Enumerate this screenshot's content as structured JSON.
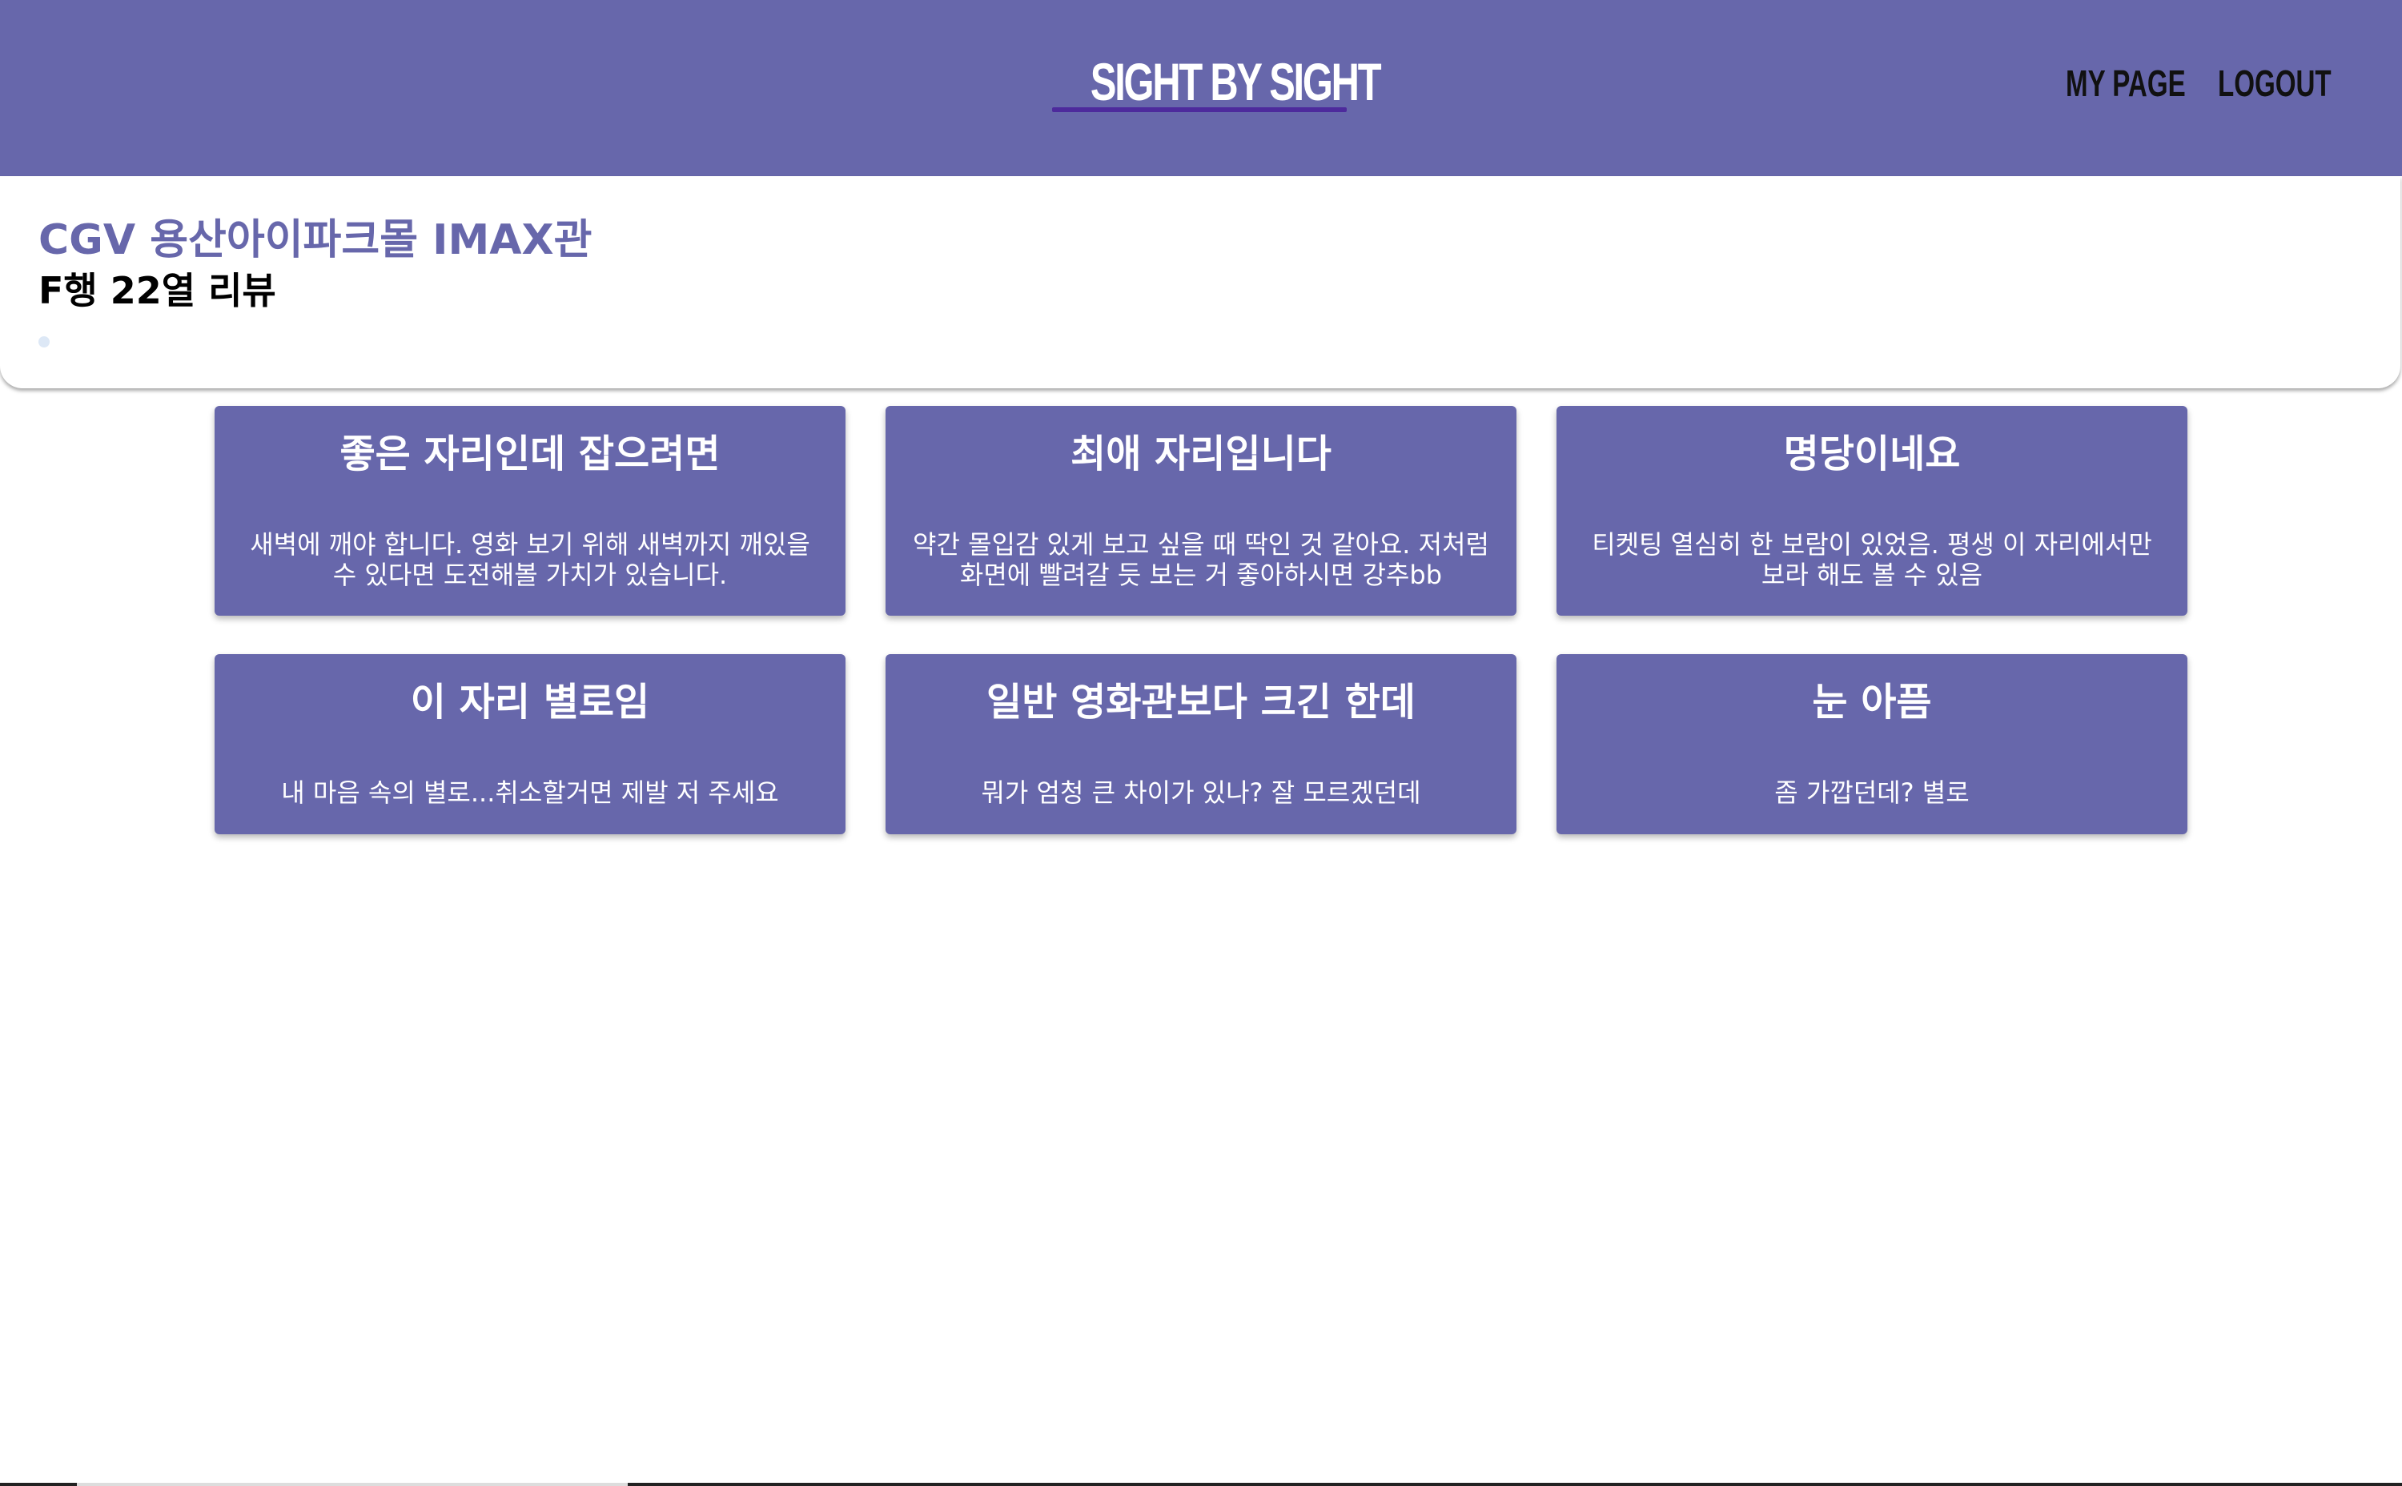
{
  "header": {
    "logo": "SIGHT BY SIGHT",
    "nav": {
      "mypage": "MY PAGE",
      "logout": "LOGOUT"
    },
    "background_color": "#6767ab"
  },
  "theater": {
    "name": "CGV 용산아이파크몰 IMAX관",
    "seat_title": "F행 22열 리뷰",
    "accent_color": "#6767ab"
  },
  "reviews": [
    {
      "title": "좋은 자리인데 잡으려면",
      "body": "새벽에 깨야 합니다. 영화 보기 위해 새벽까지 깨있을 수 있다면 도전해볼 가치가 있습니다."
    },
    {
      "title": "최애 자리입니다",
      "body": "약간 몰입감 있게 보고 싶을 때 딱인 것 같아요. 저처럼 화면에 빨려갈 듯 보는 거 좋아하시면 강추bb"
    },
    {
      "title": "명당이네요",
      "body": "티켓팅 열심히 한 보람이 있었음. 평생 이 자리에서만 보라 해도 볼 수 있음"
    },
    {
      "title": "이 자리 별로임",
      "body": "내 마음 속의 별로...취소할거면 제발 저 주세요"
    },
    {
      "title": "일반 영화관보다 크긴 한데",
      "body": "뭐가 엄청 큰 차이가 있나? 잘 모르겠던데"
    },
    {
      "title": "눈 아픔",
      "body": "좀 가깝던데? 별로"
    }
  ]
}
